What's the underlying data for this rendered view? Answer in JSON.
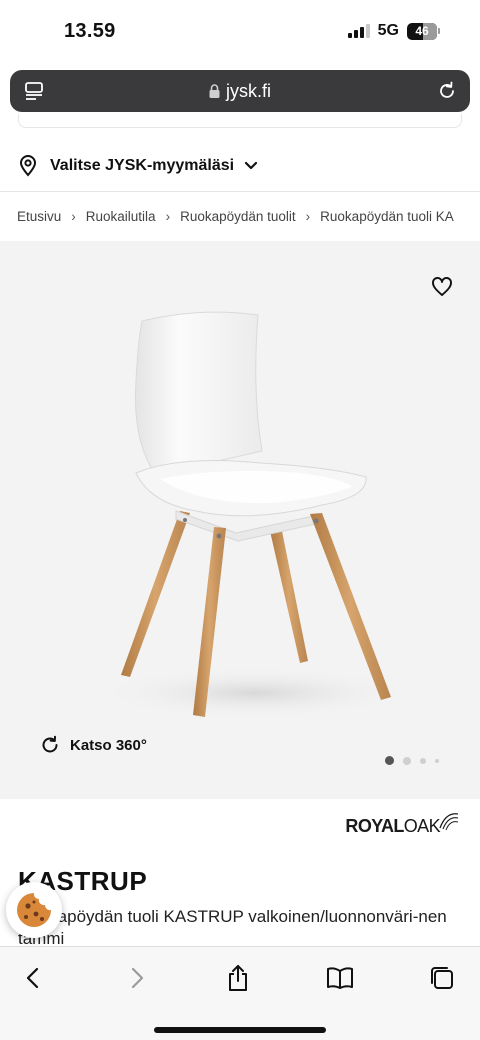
{
  "status": {
    "time": "13.59",
    "network": "5G",
    "battery": "46"
  },
  "browser": {
    "url": "jysk.fi"
  },
  "store": {
    "label": "Valitse JYSK-myymäläsi"
  },
  "breadcrumb": [
    "Etusivu",
    "Ruokailutila",
    "Ruokapöydän tuolit",
    "Ruokapöydän tuoli KA"
  ],
  "gallery": {
    "view360_label": "Katso 360°",
    "current_image": 1,
    "image_count": 4
  },
  "product": {
    "brand_bold": "ROYAL",
    "brand_light": "OAK",
    "title": "KASTRUP",
    "description": "Ruokapöydän tuoli KASTRUP valkoinen/luonnonväri-nen tammi"
  },
  "icons": {
    "tabs": "tabs-icon",
    "reload": "reload-icon",
    "lock": "lock-icon",
    "location": "location-pin-icon",
    "heart": "heart-icon",
    "rotate": "rotate-icon",
    "cookie": "cookie-icon",
    "back": "back-arrow-icon",
    "forward": "forward-arrow-icon",
    "share": "share-icon",
    "bookmarks": "bookmarks-icon",
    "tabs_overview": "tabs-overview-icon"
  },
  "colors": {
    "url_bar": "#3a3a3c",
    "gallery_bg": "#f3f3f3",
    "oak": "#c8935a",
    "dot_active": "#555555"
  }
}
